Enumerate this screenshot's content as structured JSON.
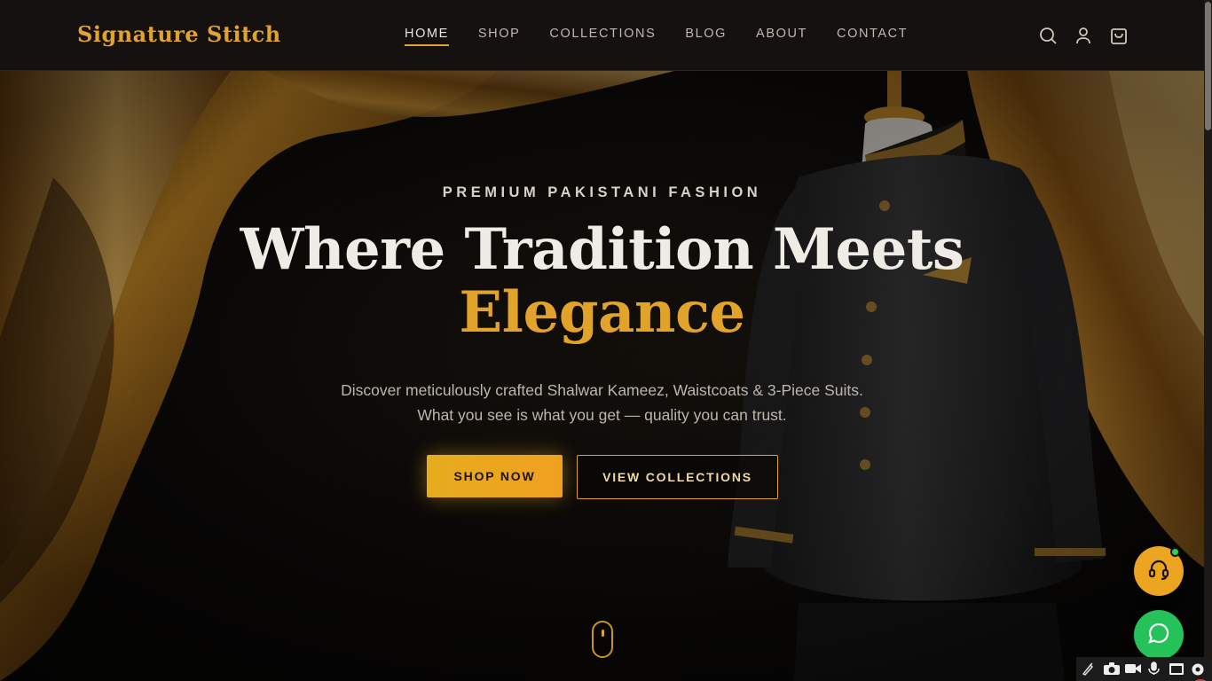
{
  "brand": {
    "name": "Signature Stitch"
  },
  "nav": {
    "items": [
      {
        "label": "HOME",
        "active": true
      },
      {
        "label": "SHOP",
        "active": false
      },
      {
        "label": "COLLECTIONS",
        "active": false
      },
      {
        "label": "BLOG",
        "active": false
      },
      {
        "label": "ABOUT",
        "active": false
      },
      {
        "label": "CONTACT",
        "active": false
      }
    ],
    "icons": [
      "search-icon",
      "user-icon",
      "shopping-bag-icon"
    ]
  },
  "hero": {
    "eyebrow": "PREMIUM PAKISTANI FASHION",
    "headline_line1": "Where Tradition Meets",
    "headline_line2": "Elegance",
    "subtext_line1": "Discover meticulously crafted Shalwar Kameez, Waistcoats & 3-Piece Suits.",
    "subtext_line2": "What you see is what you get — quality you can trust.",
    "primary_cta": "SHOP NOW",
    "secondary_cta": "VIEW COLLECTIONS"
  },
  "floating": {
    "support_icon": "headset-icon",
    "chat_icon": "chat-bubble-icon"
  },
  "tray": {
    "icons": [
      "pen-icon",
      "camera-icon",
      "video-icon",
      "microphone-icon",
      "window-icon",
      "gear-icon"
    ]
  },
  "colors": {
    "accent_gold": "#e2a32a",
    "header_bg": "#141110",
    "chat_green": "#25c25a",
    "online_dot": "#2bd44d"
  }
}
